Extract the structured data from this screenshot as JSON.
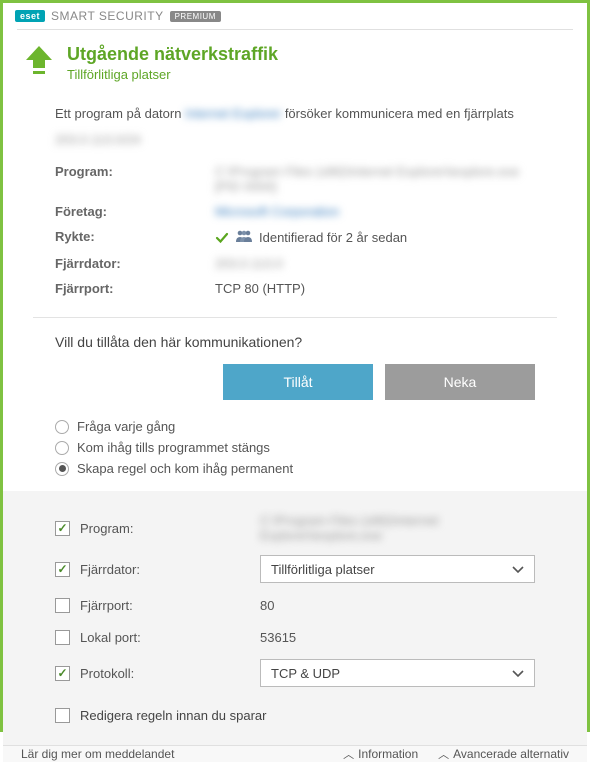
{
  "brand": {
    "logo_text": "eset",
    "product": "SMART SECURITY",
    "edition": "PREMIUM"
  },
  "alert": {
    "title": "Utgående nätverkstraffik",
    "subtitle": "Tillförlitliga platser",
    "desc_prefix": "Ett program på datorn ",
    "desc_blurred_app": "Internet Explorer",
    "desc_suffix": " försöker kommunicera med en fjärrplats",
    "desc_blurred_ip": "203.0.113.0/24"
  },
  "info": {
    "program_label": "Program:",
    "program_value": "C:\\Program Files (x86)\\Internet Explorer\\iexplore.exe [PID 0000]",
    "company_label": "Företag:",
    "company_value": "Microsoft Corporation",
    "reputation_label": "Rykte:",
    "reputation_value": "Identifierad för 2 år sedan",
    "remote_host_label": "Fjärrdator:",
    "remote_host_value": "203.0.113.0",
    "remote_port_label": "Fjärrport:",
    "remote_port_value": "TCP 80 (HTTP)"
  },
  "question": "Vill du tillåta den här kommunikationen?",
  "buttons": {
    "allow": "Tillåt",
    "deny": "Neka"
  },
  "radios": {
    "ask": "Fråga varje gång",
    "remember_session": "Kom ihåg tills programmet stängs",
    "create_rule": "Skapa regel och kom ihåg permanent",
    "selected_index": 2
  },
  "rule": {
    "program_label": "Program:",
    "program_checked": true,
    "program_value": "C:\\Program Files (x86)\\Internet Explorer\\iexplore.exe",
    "remote_host_label": "Fjärrdator:",
    "remote_host_checked": true,
    "remote_host_value": "Tillförlitliga platser",
    "remote_port_label": "Fjärrport:",
    "remote_port_checked": false,
    "remote_port_value": "80",
    "local_port_label": "Lokal port:",
    "local_port_checked": false,
    "local_port_value": "53615",
    "protocol_label": "Protokoll:",
    "protocol_checked": true,
    "protocol_value": "TCP & UDP",
    "edit_label": "Redigera regeln innan du sparar",
    "edit_checked": false
  },
  "footer": {
    "learn_more": "Lär dig mer om meddelandet",
    "info": "Information",
    "advanced": "Avancerade alternativ"
  }
}
